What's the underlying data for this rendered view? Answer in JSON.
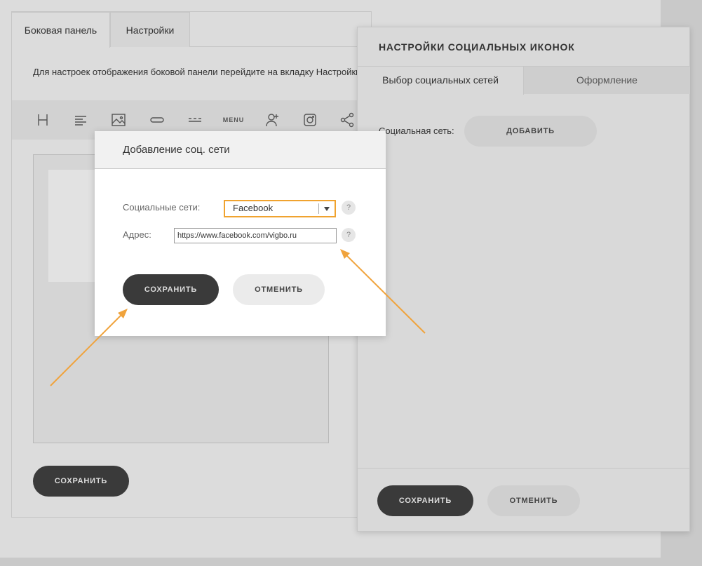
{
  "editor": {
    "tabs": [
      {
        "label": "Боковая панель"
      },
      {
        "label": "Настройки"
      }
    ],
    "info_text": "Для настроек отображения боковой панели перейдите на вкладку Настройки",
    "toolbar": {
      "menu_label": "MENU",
      "icons": [
        "heading-icon",
        "text-align-icon",
        "image-icon",
        "link-icon",
        "divider-icon",
        "menu-icon",
        "add-user-icon",
        "instagram-icon",
        "share-icon"
      ]
    },
    "save_label": "СОХРАНИТЬ"
  },
  "panel": {
    "title": "НАСТРОЙКИ СОЦИАЛЬНЫХ ИКОНОК",
    "tabs": [
      {
        "label": "Выбор социальных сетей"
      },
      {
        "label": "Оформление"
      }
    ],
    "social_label": "Социальная сеть:",
    "add_label": "ДОБАВИТЬ",
    "save_label": "СОХРАНИТЬ",
    "cancel_label": "ОТМЕНИТЬ"
  },
  "modal": {
    "title": "Добавление соц. сети",
    "networks_label": "Социальные сети:",
    "selected_network": "Facebook",
    "address_label": "Адрес:",
    "address_value": "https://www.facebook.com/vigbo.ru",
    "help_symbol": "?",
    "save_label": "СОХРАНИТЬ",
    "cancel_label": "ОТМЕНИТЬ"
  },
  "colors": {
    "highlight": "#f0a32f",
    "dark_button": "#3a3a3a",
    "arrow": "#f0a33c"
  }
}
